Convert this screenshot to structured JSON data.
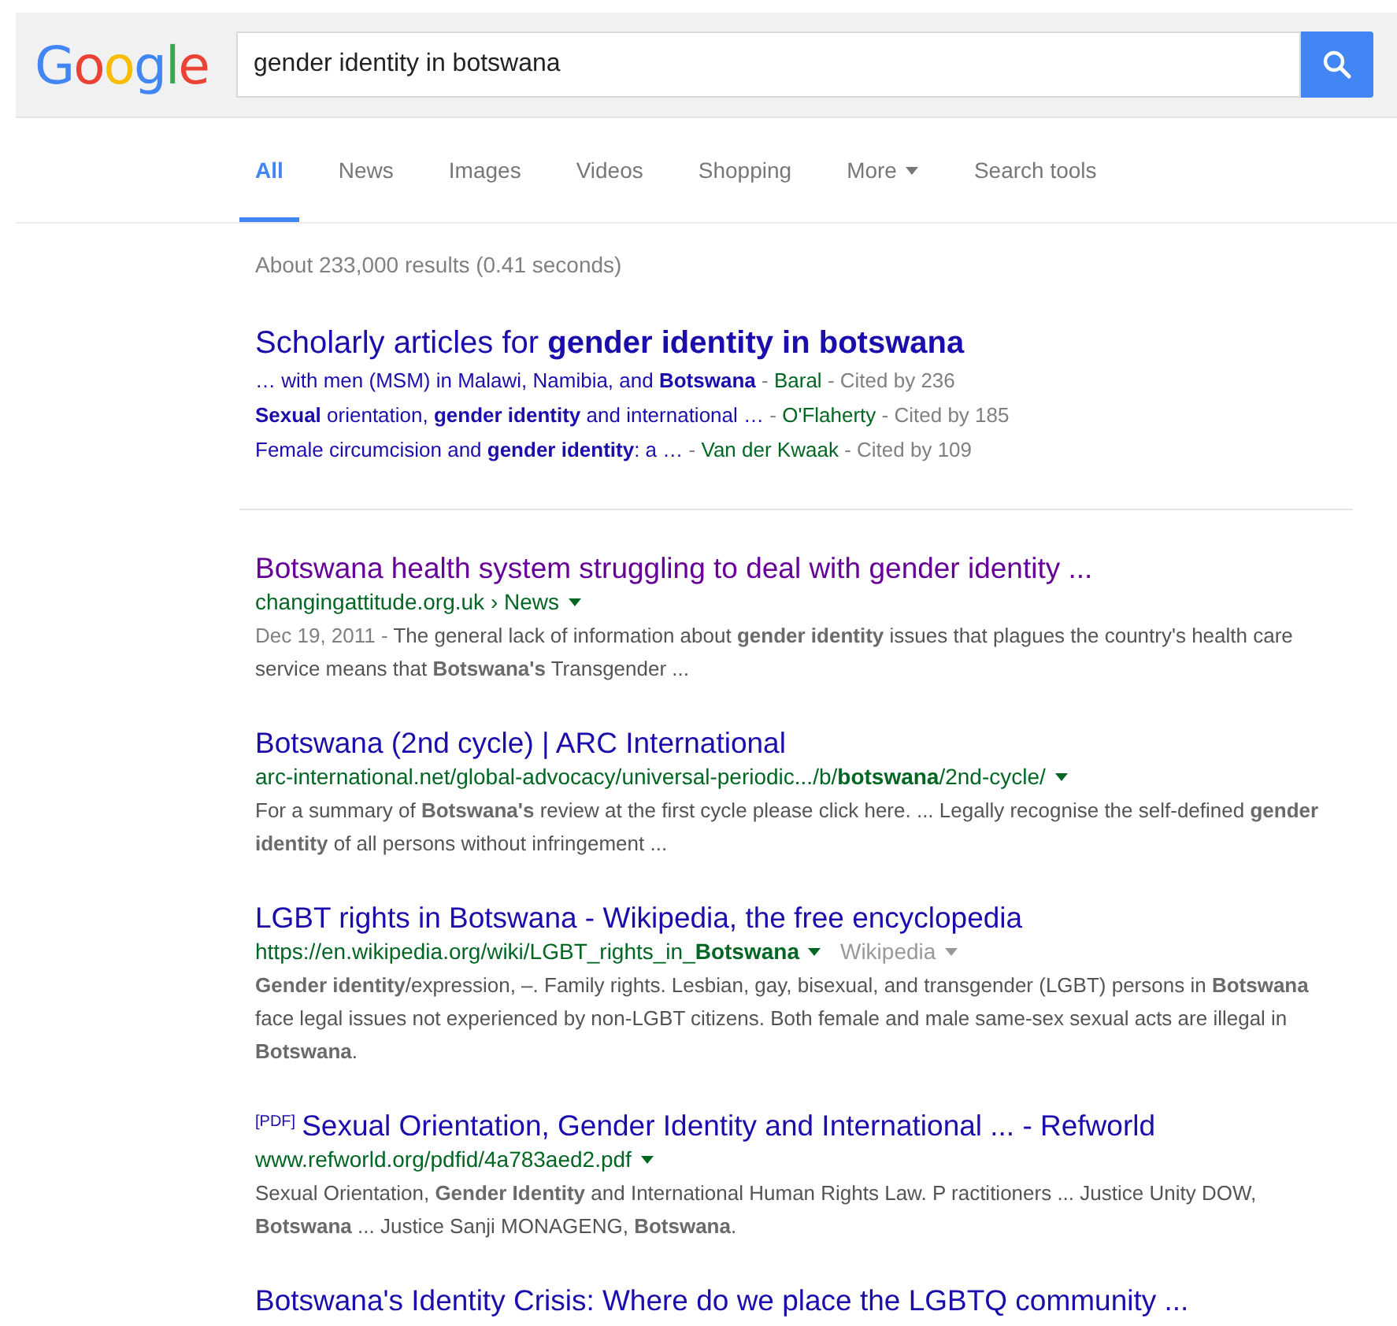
{
  "header": {
    "logo": "Google",
    "query": "gender identity in botswana"
  },
  "tabs": [
    {
      "label": "All",
      "selected": true,
      "menu": false
    },
    {
      "label": "News",
      "selected": false,
      "menu": false
    },
    {
      "label": "Images",
      "selected": false,
      "menu": false
    },
    {
      "label": "Videos",
      "selected": false,
      "menu": false
    },
    {
      "label": "Shopping",
      "selected": false,
      "menu": false
    },
    {
      "label": "More",
      "selected": false,
      "menu": true
    },
    {
      "label": "Search tools",
      "selected": false,
      "menu": false
    }
  ],
  "stats": "About 233,000 results (0.41 seconds)",
  "scholarly": {
    "title": "Scholarly articles for **gender identity in botswana**",
    "lines": [
      [
        {
          "kind": "link",
          "text": "… with men (MSM) in Malawi, Namibia, and **Botswana**"
        },
        {
          "kind": "meta",
          "text": "-"
        },
        {
          "kind": "author",
          "text": "Baral"
        },
        {
          "kind": "meta",
          "text": "- Cited by 236"
        }
      ],
      [
        {
          "kind": "link",
          "text": "**Sexual** orientation, **gender identity** and international …"
        },
        {
          "kind": "meta",
          "text": "-"
        },
        {
          "kind": "author",
          "text": "O'Flaherty"
        },
        {
          "kind": "meta",
          "text": "- Cited by 185"
        }
      ],
      [
        {
          "kind": "link",
          "text": "Female circumcision and **gender identity**: a …"
        },
        {
          "kind": "meta",
          "text": "-"
        },
        {
          "kind": "author",
          "text": "Van der Kwaak"
        },
        {
          "kind": "meta",
          "text": "- Cited by 109"
        }
      ]
    ]
  },
  "results": [
    {
      "title": "Botswana health system struggling to deal with gender identity ...",
      "visited": true,
      "url": "changingattitude.org.uk › News",
      "menu": true,
      "date": "Dec 19, 2011 -",
      "snippet": "The general lack of information about **gender identity** issues that plagues the country's health care service means that **Botswana's** Transgender ..."
    },
    {
      "title": "Botswana (2nd cycle) | ARC International",
      "visited": false,
      "url": "arc-international.net/global-advocacy/universal-periodic.../b/**botswana**/2nd-cycle/",
      "menu": true,
      "snippet": "For a summary of **Botswana's** review at the first cycle please click here. ... Legally recognise the self-defined **gender identity** of all persons without infringement ..."
    },
    {
      "title": "LGBT rights in Botswana - Wikipedia, the free encyclopedia",
      "visited": false,
      "url": "https://en.wikipedia.org/wiki/LGBT_rights_in_**Botswana**",
      "menu": true,
      "source": "Wikipedia",
      "snippet": "**Gender identity**/expression, –. Family rights. Lesbian, gay, bisexual, and transgender (LGBT) persons in **Botswana** face legal issues not experienced by non-LGBT citizens. Both female and male same-sex sexual acts are illegal in **Botswana**."
    },
    {
      "tag": "[PDF]",
      "title": "Sexual Orientation, Gender Identity and International ... - Refworld",
      "visited": false,
      "url": "www.refworld.org/pdfid/4a783aed2.pdf",
      "menu": true,
      "snippet": "Sexual Orientation, **Gender Identity** and International Human Rights Law. P ractitioners ... Justice Unity DOW, **Botswana** ... Justice Sanji MONAGENG, **Botswana**."
    },
    {
      "title": "Botswana's Identity Crisis: Where do we place the LGBTQ community ...",
      "visited": false
    }
  ]
}
